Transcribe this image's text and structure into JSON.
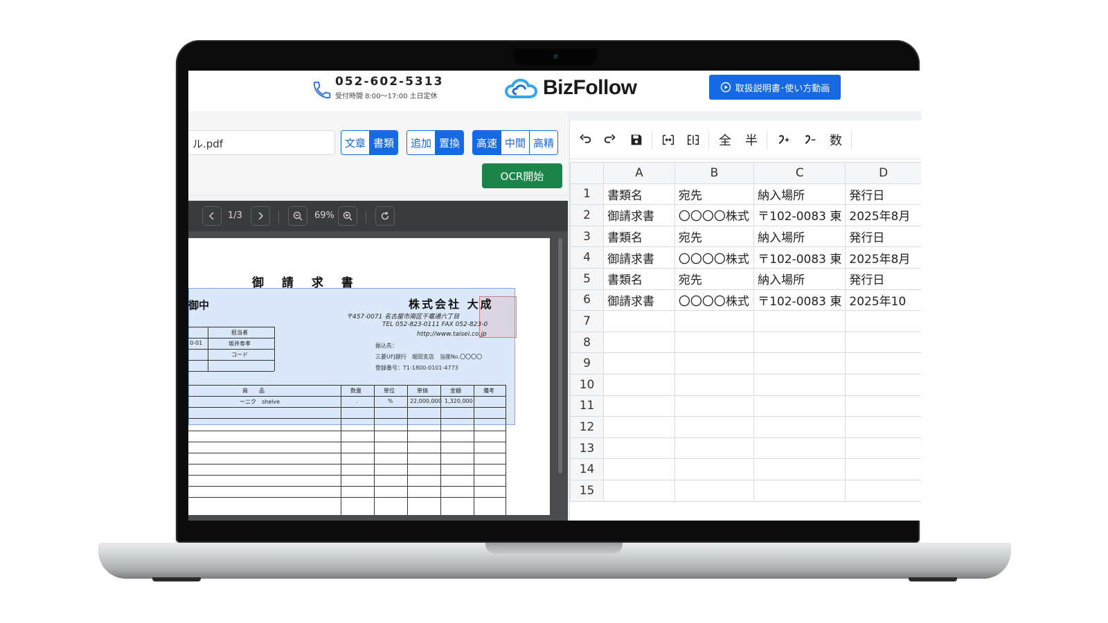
{
  "header": {
    "phone_number": "052-602-5313",
    "phone_hours": "受付時間 8:00〜17:00 土日定休",
    "logo_text": "BizFollow",
    "manual_button": "取扱説明書･使い方動画"
  },
  "left_toolbar": {
    "file_name": "ル.pdf",
    "mode_group": [
      {
        "label": "文章",
        "active": false
      },
      {
        "label": "書類",
        "active": true
      }
    ],
    "write_group": [
      {
        "label": "追加",
        "active": false
      },
      {
        "label": "置換",
        "active": true
      }
    ],
    "speed_group": [
      {
        "label": "高速",
        "active": true
      },
      {
        "label": "中間",
        "active": false
      },
      {
        "label": "高精",
        "active": false
      }
    ],
    "ocr_button": "OCR開始"
  },
  "pdf_viewer": {
    "page_indicator": "1/3",
    "zoom": "69%"
  },
  "document": {
    "title": "御 請 求 書",
    "recipient": "  御中",
    "company": "株式会社 大成",
    "address_lines": [
      "〒457-0071 名古屋市南区千竈通六丁目",
      "TEL 052-823-0111  FAX 052-823-0",
      "http://www.taisei.co.jp"
    ],
    "info_label": "振込先：",
    "bank_line": "三菱UFJ銀行　堀田支店　当座No.〇〇〇〇",
    "registration_line": "登録番号：T1-1800-0101-4773",
    "person_header": "担当者",
    "person_name": "坂井寿孝",
    "code_header": "コード",
    "left_cell": "0-01",
    "item_headers": [
      "商　　品",
      "数量",
      "単位",
      "単価",
      "金額",
      "備考"
    ],
    "item_row": [
      "ーニク　shelve",
      ".",
      "%",
      "22,000,000",
      "1,320,000",
      ""
    ]
  },
  "sheet_toolbar": {
    "labels": [
      "全",
      "半",
      "数"
    ]
  },
  "sheet": {
    "columns": [
      "A",
      "B",
      "C",
      "D"
    ],
    "rows": [
      [
        "書類名",
        "宛先",
        "納入場所",
        "発行日"
      ],
      [
        "御請求書",
        "〇〇〇〇株式",
        "〒102-0083 東",
        "2025年8月"
      ],
      [
        "書類名",
        "宛先",
        "納入場所",
        "発行日"
      ],
      [
        "御請求書",
        "〇〇〇〇株式",
        "〒102-0083 東",
        "2025年8月"
      ],
      [
        "書類名",
        "宛先",
        "納入場所",
        "発行日"
      ],
      [
        "御請求書",
        "〇〇〇〇株式",
        "〒102-0083 東",
        "2025年10"
      ],
      [
        "",
        "",
        "",
        ""
      ],
      [
        "",
        "",
        "",
        ""
      ],
      [
        "",
        "",
        "",
        ""
      ],
      [
        "",
        "",
        "",
        ""
      ],
      [
        "",
        "",
        "",
        ""
      ],
      [
        "",
        "",
        "",
        ""
      ],
      [
        "",
        "",
        "",
        ""
      ],
      [
        "",
        "",
        "",
        ""
      ],
      [
        "",
        "",
        "",
        ""
      ]
    ],
    "row_numbers": [
      "1",
      "2",
      "3",
      "4",
      "5",
      "6",
      "7",
      "8",
      "9",
      "10",
      "11",
      "12",
      "13",
      "14",
      "15"
    ]
  },
  "colors": {
    "primary": "#1668e3",
    "ocr_green": "#1b8549",
    "viewer_dark": "#3a3b3d"
  }
}
